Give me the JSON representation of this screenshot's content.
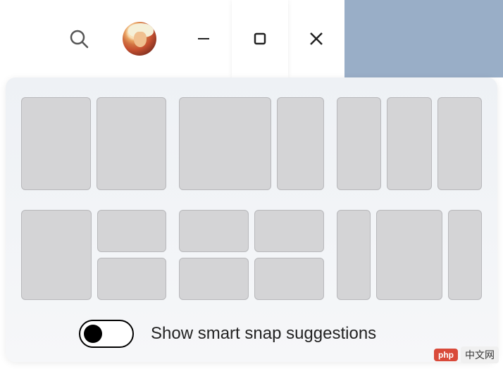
{
  "window": {
    "controls": {
      "minimize": "minimize",
      "maximize": "maximize",
      "close": "close"
    }
  },
  "snap_flyout": {
    "layouts": [
      {
        "id": "two-even",
        "columns": [
          "50",
          "50"
        ]
      },
      {
        "id": "two-left-wide",
        "columns": [
          "66",
          "34"
        ]
      },
      {
        "id": "three-even",
        "columns": [
          "33",
          "33",
          "33"
        ]
      },
      {
        "id": "left-plus-stack",
        "columns": [
          "50",
          "stack2"
        ]
      },
      {
        "id": "quad",
        "columns": [
          "stack2",
          "stack2"
        ]
      },
      {
        "id": "three-center-wide",
        "columns": [
          "25",
          "50",
          "25"
        ]
      }
    ],
    "toggle": {
      "state": "off",
      "label": "Show smart snap suggestions"
    }
  },
  "watermark": {
    "badge": "php",
    "text": "中文网"
  }
}
